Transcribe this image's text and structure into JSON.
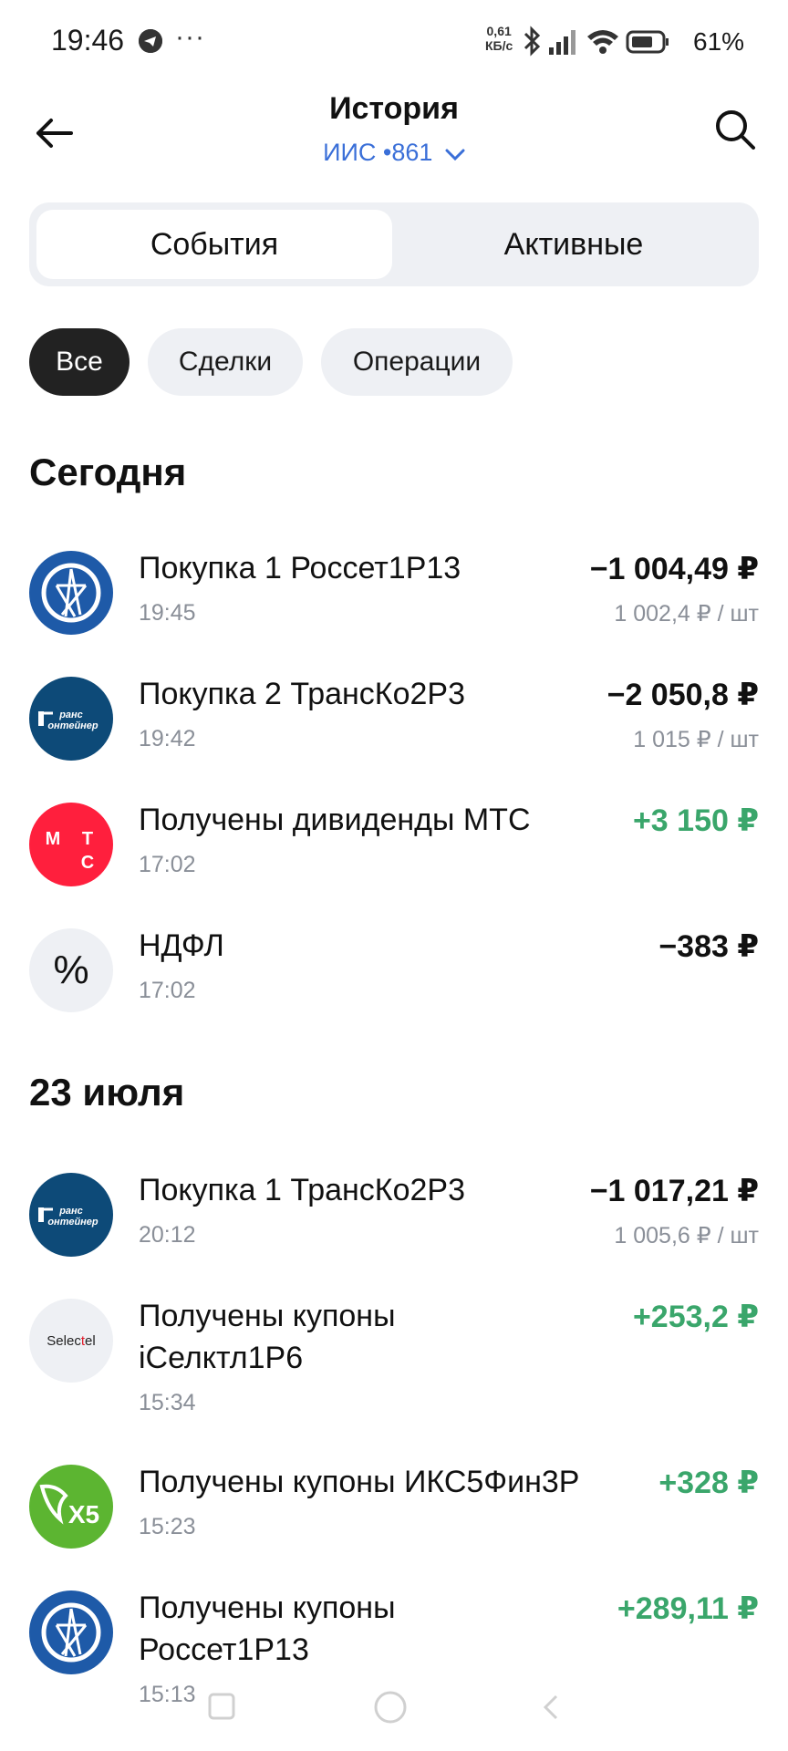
{
  "status": {
    "time": "19:46",
    "dots": "···",
    "speed_value": "0,61",
    "speed_unit": "КБ/с",
    "battery": "61%",
    "icons": [
      "telegram-icon",
      "bluetooth-icon",
      "signal-icon",
      "wifi-icon",
      "battery-icon"
    ]
  },
  "header": {
    "title": "История",
    "account": "ИИС •861",
    "back_icon": "back-arrow-icon",
    "search_icon": "search-icon"
  },
  "tabs": [
    {
      "label": "События",
      "active": true
    },
    {
      "label": "Активные",
      "active": false
    }
  ],
  "filters": [
    {
      "label": "Все",
      "active": true
    },
    {
      "label": "Сделки",
      "active": false
    },
    {
      "label": "Операции",
      "active": false
    }
  ],
  "sections": [
    {
      "heading": "Сегодня",
      "items": [
        {
          "logo": "rosset-logo",
          "title": "Покупка 1 Россет1Р13",
          "time": "19:45",
          "amount": "−1 004,49 ₽",
          "sub": "1 002,4 ₽ / шт",
          "positive": false
        },
        {
          "logo": "transcontainer-logo",
          "title": "Покупка 2 ТрансКо2Р3",
          "time": "19:42",
          "amount": "−2 050,8 ₽",
          "sub": "1 015 ₽ / шт",
          "positive": false
        },
        {
          "logo": "mts-logo",
          "title": "Получены дивиденды МТС",
          "time": "17:02",
          "amount": "+3 150 ₽",
          "sub": "",
          "positive": true
        },
        {
          "logo": "percent-icon",
          "title": "НДФЛ",
          "time": "17:02",
          "amount": "−383 ₽",
          "sub": "",
          "positive": false
        }
      ]
    },
    {
      "heading": "23 июля",
      "items": [
        {
          "logo": "transcontainer-logo",
          "title": "Покупка 1 ТрансКо2Р3",
          "time": "20:12",
          "amount": "−1 017,21 ₽",
          "sub": "1 005,6 ₽ / шт",
          "positive": false
        },
        {
          "logo": "selectel-logo",
          "title": "Получены купоны iСелктл1Р6",
          "time": "15:34",
          "amount": "+253,2 ₽",
          "sub": "",
          "positive": true
        },
        {
          "logo": "x5-logo",
          "title": "Получены купоны ИКС5Фин3Р",
          "time": "15:23",
          "amount": "+328 ₽",
          "sub": "",
          "positive": true
        },
        {
          "logo": "rosset-logo",
          "title": "Получены купоны Россет1Р13",
          "time": "15:13",
          "amount": "+289,11 ₽",
          "sub": "",
          "positive": true
        }
      ]
    }
  ],
  "logos_text": {
    "transcontainer": "рансонтейнер",
    "mts": "МТС",
    "selectel": "Selectel",
    "x5": "X5"
  },
  "colors": {
    "accent": "#3a6fd8",
    "positive": "#3aa66b",
    "muted": "#8a8f98",
    "chip_bg": "#eef0f4",
    "chip_active": "#222222",
    "rosset": "#1e5aa8",
    "transcontainer": "#0d4a78",
    "mts": "#ff1f3d",
    "x5": "#5cb531"
  }
}
